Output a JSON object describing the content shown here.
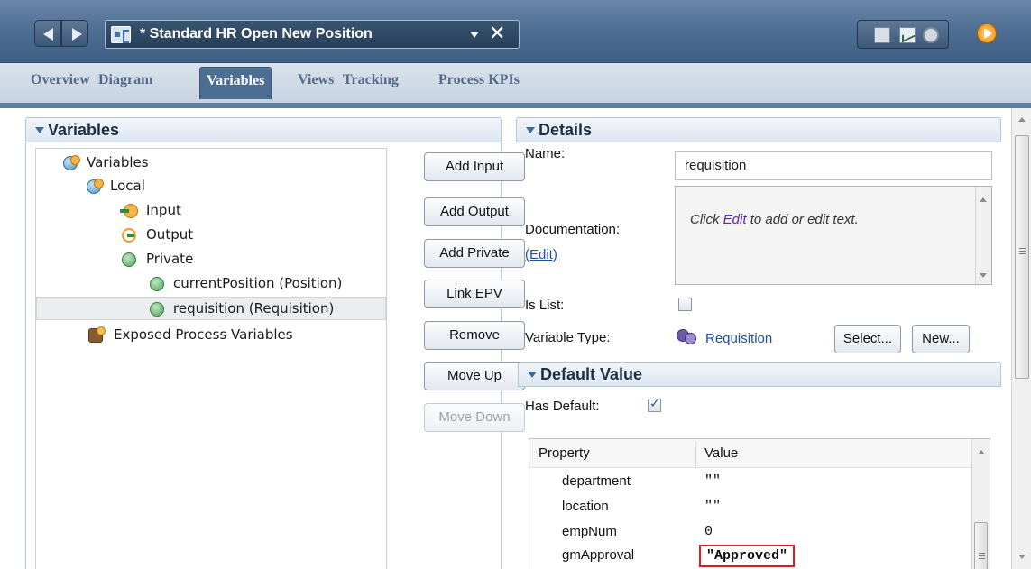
{
  "window": {
    "title": "* Standard HR Open New Position"
  },
  "tabs": [
    {
      "label": "Overview"
    },
    {
      "label": "Diagram"
    },
    {
      "label": "Variables"
    },
    {
      "label": "Views"
    },
    {
      "label": "Tracking"
    },
    {
      "label": "Process KPIs"
    }
  ],
  "active_tab": "Variables",
  "variables_panel": {
    "header": "Variables",
    "tree": [
      {
        "label": "Variables",
        "icon": "variables-icon",
        "level": 0
      },
      {
        "label": "Local",
        "icon": "variables-icon",
        "level": 1
      },
      {
        "label": "Input",
        "icon": "input-variable-icon",
        "level": 2
      },
      {
        "label": "Output",
        "icon": "output-variable-icon",
        "level": 2
      },
      {
        "label": "Private",
        "icon": "private-variable-icon",
        "level": 2
      },
      {
        "label": "currentPosition (Position)",
        "icon": "private-variable-icon",
        "level": 3
      },
      {
        "label": "requisition (Requisition)",
        "icon": "private-variable-icon",
        "level": 3,
        "selected": true
      },
      {
        "label": "Exposed Process Variables",
        "icon": "exposed-process-variables-icon",
        "level": 1
      }
    ],
    "buttons": {
      "add_input": "Add Input",
      "add_output": "Add Output",
      "add_private": "Add Private",
      "link_epv": "Link EPV",
      "remove": "Remove",
      "move_up": "Move Up",
      "move_down": "Move Down"
    }
  },
  "details_panel": {
    "header": "Details",
    "name_label": "Name:",
    "name_value": "requisition",
    "documentation_label": "Documentation:",
    "documentation_edit_link": "(Edit)",
    "documentation_hint_prefix": "Click ",
    "documentation_hint_link": "Edit",
    "documentation_hint_suffix": " to add or edit text.",
    "is_list_label": "Is List:",
    "is_list_checked": false,
    "variable_type_label": "Variable Type:",
    "variable_type_value": "Requisition",
    "select_button": "Select...",
    "new_button": "New..."
  },
  "default_value_panel": {
    "header": "Default Value",
    "has_default_label": "Has Default:",
    "has_default_checked": true,
    "columns": {
      "property": "Property",
      "value": "Value"
    },
    "rows": [
      {
        "property": "department",
        "value": "\"\""
      },
      {
        "property": "location",
        "value": "\"\""
      },
      {
        "property": "empNum",
        "value": "0"
      },
      {
        "property": "gmApproval",
        "value": "\"Approved\"",
        "highlighted": true
      }
    ]
  },
  "colors": {
    "title_bar": "#4d6d92",
    "highlight_border": "#e01b1b",
    "link": "#1f4fa6"
  }
}
